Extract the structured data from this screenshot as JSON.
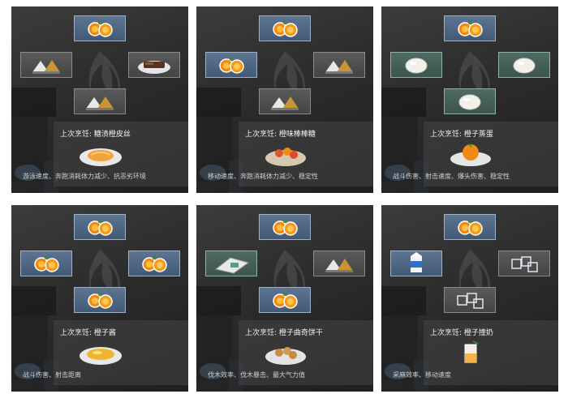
{
  "panels": [
    {
      "top": "orange",
      "left": "salt-pepper",
      "right": "meat",
      "bottom": "salt-pepper",
      "top_color": "blue",
      "left_color": "gray",
      "right_color": "gray",
      "bottom_color": "gray",
      "last_cooked": "上次烹饪: 糖渍橙皮丝",
      "dish_icon": "candied-orange-peel-icon",
      "effects": "游泳速度、奔跑消耗体力减少、抗恶劣环境"
    },
    {
      "top": "orange",
      "left": "orange",
      "right": "salt-pepper",
      "bottom": "salt-pepper",
      "top_color": "blue",
      "left_color": "blue",
      "right_color": "gray",
      "bottom_color": "gray",
      "last_cooked": "上次烹饪: 橙味棒棒糖",
      "dish_icon": "orange-lollipop-icon",
      "effects": "移动速度、奔跑消耗体力减少、稳定性"
    },
    {
      "top": "orange",
      "left": "egg",
      "right": "egg",
      "bottom": "egg",
      "top_color": "blue",
      "left_color": "green",
      "right_color": "green",
      "bottom_color": "green",
      "last_cooked": "上次烹饪: 橙子蒸蛋",
      "dish_icon": "orange-steamed-egg-icon",
      "effects": "战斗伤害、射击速度、爆头伤害、稳定性"
    },
    {
      "top": "orange",
      "left": "orange",
      "right": "orange",
      "bottom": "orange",
      "top_color": "blue",
      "left_color": "blue",
      "right_color": "blue",
      "bottom_color": "blue",
      "last_cooked": "上次烹饪: 橙子酱",
      "dish_icon": "orange-jam-icon",
      "effects": "战斗伤害、射击距离"
    },
    {
      "top": "orange",
      "left": "flour",
      "right": "salt-pepper",
      "bottom": "orange",
      "top_color": "blue",
      "left_color": "green",
      "right_color": "gray",
      "bottom_color": "blue",
      "last_cooked": "上次烹饪: 橙子曲奇饼干",
      "dish_icon": "orange-cookies-icon",
      "effects": "伐木效率、伐木暴击、最大气力值"
    },
    {
      "top": "orange",
      "left": "milk",
      "right": "ice",
      "bottom": "ice",
      "top_color": "blue",
      "left_color": "blue",
      "right_color": "gray",
      "bottom_color": "gray",
      "last_cooked": "上次烹饪: 橙子撞奶",
      "dish_icon": "orange-milk-drink-icon",
      "effects": "采麻效率、移动速度"
    }
  ]
}
